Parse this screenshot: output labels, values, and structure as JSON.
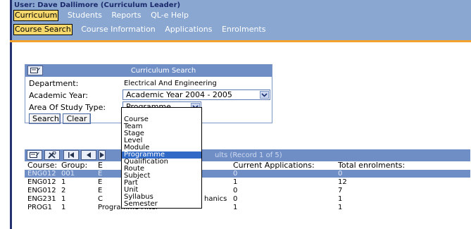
{
  "header": {
    "user_line": "User: Dave Dallimore (Curriculum Leader)",
    "main_menu": [
      {
        "label": "Curriculum",
        "active": true
      },
      {
        "label": "Students",
        "active": false
      },
      {
        "label": "Reports",
        "active": false
      },
      {
        "label": "QL-e Help",
        "active": false
      }
    ],
    "sub_menu": [
      {
        "label": "Course Search",
        "active": true
      },
      {
        "label": "Course Information",
        "active": false
      },
      {
        "label": "Applications",
        "active": false
      },
      {
        "label": "Enrolments",
        "active": false
      }
    ]
  },
  "search_panel": {
    "title": "Curriculum Search",
    "department_label": "Department:",
    "department_value": "Electrical And Engineering",
    "academic_year_label": "Academic Year:",
    "academic_year_value": "Academic Year 2004 - 2005",
    "area_label": "Area Of Study Type:",
    "area_value": "Programme",
    "search_button": "Search",
    "clear_button": "Clear"
  },
  "dropdown": {
    "options": [
      "Course",
      "Team",
      "Stage",
      "Level",
      "Module",
      "Programme",
      "Qualification",
      "Route",
      "Subject",
      "Part",
      "Unit",
      "Syllabus",
      "Semester"
    ],
    "highlighted": "Programme"
  },
  "results": {
    "title_visible": "ults (Record 1 of 5)",
    "columns": [
      "Course:",
      "Group:",
      "E",
      "Current Applications:",
      "Total enrolments:"
    ],
    "rows": [
      {
        "course": "ENG012",
        "group": "001",
        "desc": "E",
        "apps": "0",
        "enrol": "0",
        "selected": true
      },
      {
        "course": "ENG012",
        "group": "1",
        "desc": "E",
        "apps": "1",
        "enrol": "12",
        "selected": false
      },
      {
        "course": "ENG012",
        "group": "2",
        "desc": "E",
        "apps": "0",
        "enrol": "7",
        "selected": false
      },
      {
        "course": "ENG231",
        "group": "1",
        "desc": "C",
        "apps": "0",
        "enrol": "1",
        "selected": false
      },
      {
        "course": "PROG1",
        "group": "1",
        "desc": "Programme Filter",
        "apps": "1",
        "enrol": "1",
        "selected": false
      }
    ],
    "visible_fragments": {
      "row2": "g",
      "row3": "g",
      "row4": "hanics"
    }
  },
  "colors": {
    "header_band": "#8aa7d1",
    "panel_title": "#6f8ec6",
    "accent_orange": "#f2a12a",
    "selection": "#3169c6"
  }
}
